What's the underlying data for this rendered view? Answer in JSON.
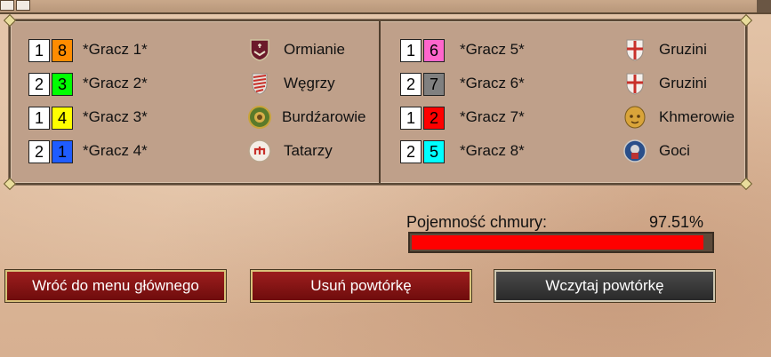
{
  "players_left": [
    {
      "team": "1",
      "color_num": "8",
      "color": "#ff8c00",
      "name": "*Gracz 1*",
      "civ": "Ormianie",
      "icon": "armenian-shield-icon"
    },
    {
      "team": "2",
      "color_num": "3",
      "color": "#00ff00",
      "name": "*Gracz 2*",
      "civ": "Węgrzy",
      "icon": "hungarian-shield-icon"
    },
    {
      "team": "1",
      "color_num": "4",
      "color": "#ffff00",
      "name": "*Gracz 3*",
      "civ": "Burdźarowie",
      "icon": "burgundian-emblem-icon"
    },
    {
      "team": "2",
      "color_num": "1",
      "color": "#1f5cff",
      "name": "*Gracz 4*",
      "civ": "Tatarzy",
      "icon": "tatar-emblem-icon"
    }
  ],
  "players_right": [
    {
      "team": "1",
      "color_num": "6",
      "color": "#ff66cc",
      "name": "*Gracz 5*",
      "civ": "Gruzini",
      "icon": "georgian-shield-icon"
    },
    {
      "team": "2",
      "color_num": "7",
      "color": "#808080",
      "name": "*Gracz 6*",
      "civ": "Gruzini",
      "icon": "georgian-shield-icon"
    },
    {
      "team": "1",
      "color_num": "2",
      "color": "#ff0000",
      "name": "*Gracz 7*",
      "civ": "Khmerowie",
      "icon": "khmer-mask-icon"
    },
    {
      "team": "2",
      "color_num": "5",
      "color": "#00ffff",
      "name": "*Gracz 8*",
      "civ": "Goci",
      "icon": "goth-emblem-icon"
    }
  ],
  "cloud": {
    "label": "Pojemność chmury:",
    "value": "97.51%",
    "fraction": 0.9751
  },
  "buttons": {
    "back": "Wróć do menu głównego",
    "delete": "Usuń powtórkę",
    "load": "Wczytaj powtórkę"
  },
  "colors": {
    "button_red": "#8a1414",
    "button_dark": "#3a3a3a",
    "bar_fill": "#ff0000"
  }
}
